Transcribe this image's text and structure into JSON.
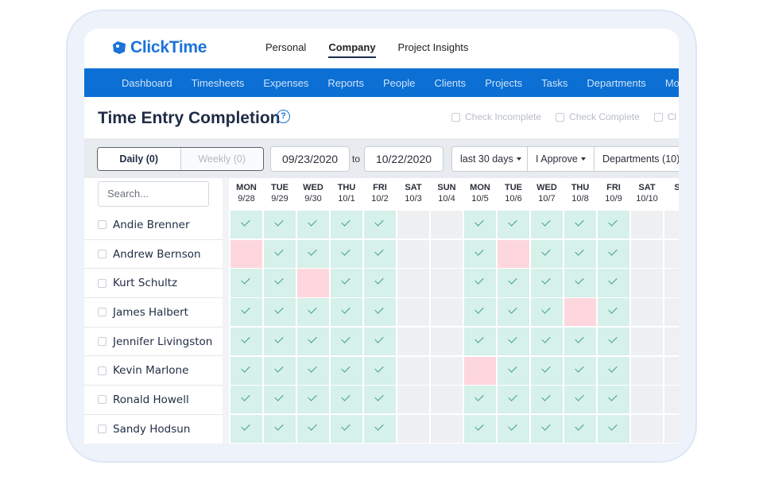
{
  "app": {
    "logo_text": "ClickTime",
    "brand_color": "#1a73d9",
    "nav_color": "#0b6fd3"
  },
  "topnav": [
    {
      "label": "Personal",
      "active": false
    },
    {
      "label": "Company",
      "active": true
    },
    {
      "label": "Project Insights",
      "active": false
    }
  ],
  "mainnav": [
    "Dashboard",
    "Timesheets",
    "Expenses",
    "Reports",
    "People",
    "Clients",
    "Projects",
    "Tasks",
    "Departments",
    "More"
  ],
  "page": {
    "title": "Time Entry Completion",
    "check_incomplete": "Check Incomplete",
    "check_complete": "Check Complete",
    "check_third": "Cl"
  },
  "filters": {
    "daily": "Daily (0)",
    "weekly": "Weekly (0)",
    "start_date": "09/23/2020",
    "to": "to",
    "end_date": "10/22/2020",
    "range": "last 30 days",
    "approver": "I Approve",
    "departments": "Departments (10)"
  },
  "search": {
    "placeholder": "Search..."
  },
  "days": [
    {
      "dow": "MON",
      "date": "9/28"
    },
    {
      "dow": "TUE",
      "date": "9/29"
    },
    {
      "dow": "WED",
      "date": "9/30"
    },
    {
      "dow": "THU",
      "date": "10/1"
    },
    {
      "dow": "FRI",
      "date": "10/2"
    },
    {
      "dow": "SAT",
      "date": "10/3"
    },
    {
      "dow": "SUN",
      "date": "10/4"
    },
    {
      "dow": "MON",
      "date": "10/5"
    },
    {
      "dow": "TUE",
      "date": "10/6"
    },
    {
      "dow": "WED",
      "date": "10/7"
    },
    {
      "dow": "THU",
      "date": "10/8"
    },
    {
      "dow": "FRI",
      "date": "10/9"
    },
    {
      "dow": "SAT",
      "date": "10/10"
    },
    {
      "dow": "SU",
      "date": ""
    }
  ],
  "people": [
    {
      "name": "Andie Brenner",
      "status": [
        "c",
        "c",
        "c",
        "c",
        "c",
        "w",
        "w",
        "c",
        "c",
        "c",
        "c",
        "c",
        "w",
        "w"
      ]
    },
    {
      "name": "Andrew Bernson",
      "status": [
        "m",
        "c",
        "c",
        "c",
        "c",
        "w",
        "w",
        "c",
        "m",
        "c",
        "c",
        "c",
        "w",
        "w"
      ]
    },
    {
      "name": "Kurt Schultz",
      "status": [
        "c",
        "c",
        "m",
        "c",
        "c",
        "w",
        "w",
        "c",
        "c",
        "c",
        "c",
        "c",
        "w",
        "w"
      ]
    },
    {
      "name": "James Halbert",
      "status": [
        "c",
        "c",
        "c",
        "c",
        "c",
        "w",
        "w",
        "c",
        "c",
        "c",
        "m",
        "c",
        "w",
        "w"
      ]
    },
    {
      "name": "Jennifer Livingston",
      "status": [
        "c",
        "c",
        "c",
        "c",
        "c",
        "w",
        "w",
        "c",
        "c",
        "c",
        "c",
        "c",
        "w",
        "w"
      ]
    },
    {
      "name": "Kevin Marlone",
      "status": [
        "c",
        "c",
        "c",
        "c",
        "c",
        "w",
        "w",
        "m",
        "c",
        "c",
        "c",
        "c",
        "w",
        "w"
      ]
    },
    {
      "name": "Ronald Howell",
      "status": [
        "c",
        "c",
        "c",
        "c",
        "c",
        "w",
        "w",
        "c",
        "c",
        "c",
        "c",
        "c",
        "w",
        "w"
      ]
    },
    {
      "name": "Sandy Hodsun",
      "status": [
        "c",
        "c",
        "c",
        "c",
        "c",
        "w",
        "w",
        "c",
        "c",
        "c",
        "c",
        "c",
        "w",
        "w"
      ]
    }
  ],
  "colors": {
    "complete": "#d6f0ea",
    "missing": "#fdd7dd",
    "weekend": "#eef0f2",
    "check": "#3a9f86"
  }
}
